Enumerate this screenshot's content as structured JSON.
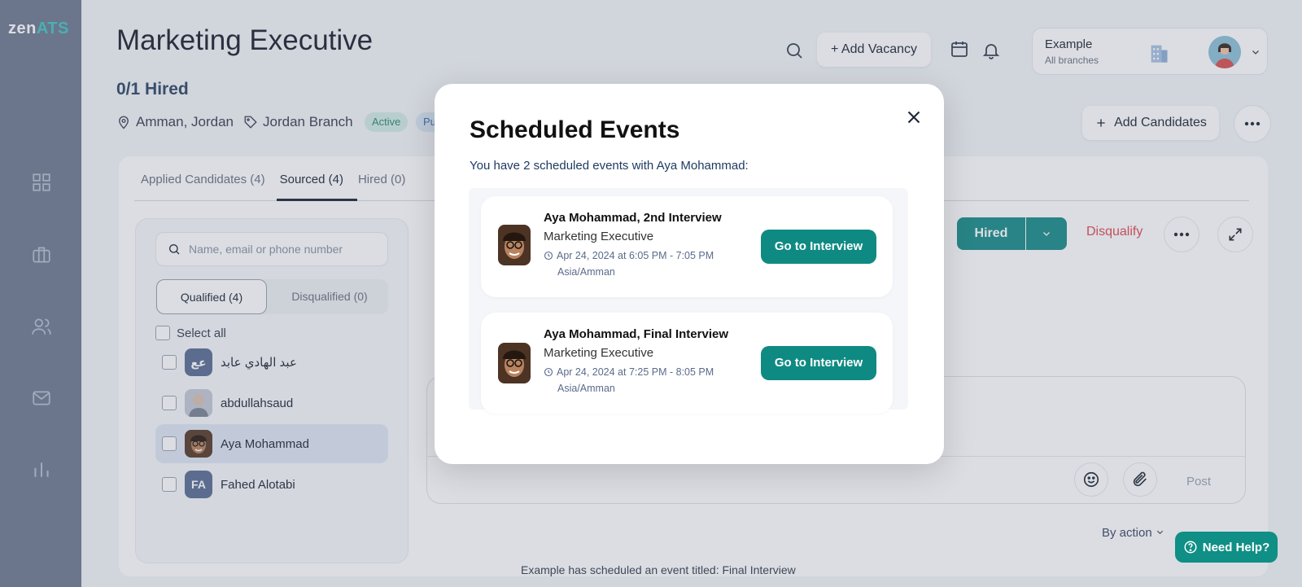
{
  "app": {
    "logo_main": "zen",
    "logo_accent": "ATS"
  },
  "header": {
    "title": "Marketing Executive",
    "hired_count": "0/1 Hired",
    "location": "Amman, Jordan",
    "branch": "Jordan Branch",
    "status_badge": "Active",
    "visibility_badge": "Pu",
    "add_vacancy": "+ Add Vacancy",
    "account_name": "Example",
    "account_scope": "All branches",
    "add_candidates": "Add Candidates"
  },
  "tabs": [
    {
      "label": "Applied Candidates (4)"
    },
    {
      "label": "Sourced (4)"
    },
    {
      "label": "Hired (0)"
    }
  ],
  "left_panel": {
    "search_placeholder": "Name, email or phone number",
    "qualified_tab": "Qualified (4)",
    "disqualified_tab": "Disqualified (0)",
    "select_all": "Select all",
    "candidates": [
      {
        "name": "عبد الهادي عابد",
        "initials": "عع",
        "avatar_color": "#5c6f94"
      },
      {
        "name": "abdullahsaud",
        "initials": "",
        "avatar_color": "#b7bec9"
      },
      {
        "name": "Aya Mohammad",
        "initials": "",
        "avatar_color": "#8a5a3b"
      },
      {
        "name": "Fahed Alotabi",
        "initials": "FA",
        "avatar_color": "#5c6f94"
      }
    ]
  },
  "actions": {
    "hired": "Hired",
    "disqualify": "Disqualify",
    "post": "Post",
    "by_action": "By action",
    "need_help": "Need Help?"
  },
  "feed": {
    "entry_text": "Example has scheduled an event titled: Final Interview"
  },
  "modal": {
    "title": "Scheduled Events",
    "subtitle": "You have 2 scheduled events with Aya Mohammad:",
    "events": [
      {
        "title": "Aya Mohammad, 2nd Interview",
        "role": "Marketing Executive",
        "datetime": "Apr 24, 2024 at 6:05 PM - 7:05 PM",
        "timezone": "Asia/Amman",
        "button": "Go to Interview"
      },
      {
        "title": "Aya Mohammad, Final Interview",
        "role": "Marketing Executive",
        "datetime": "Apr 24, 2024 at 7:25 PM - 8:05 PM",
        "timezone": "Asia/Amman",
        "button": "Go to Interview"
      }
    ]
  },
  "colors": {
    "sidebar": "#707b93",
    "teal": "#0f8a83",
    "danger": "#e04b55"
  }
}
